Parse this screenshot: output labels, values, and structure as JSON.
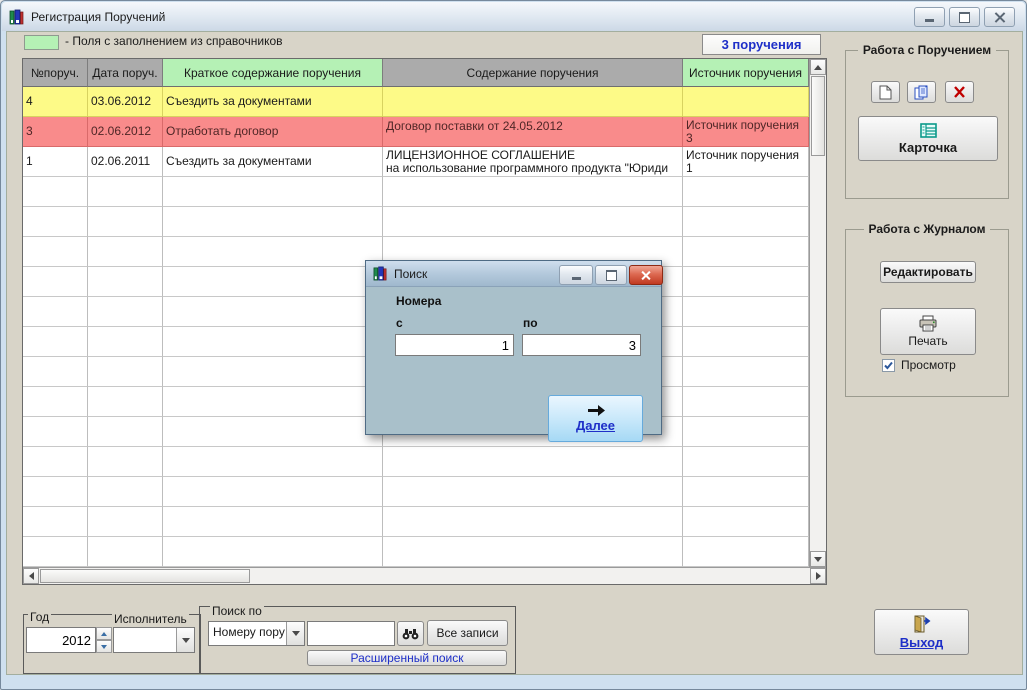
{
  "window": {
    "title": "Регистрация Поручений"
  },
  "legend_text": "- Поля с заполнением из справочников",
  "badge": "3 поручения",
  "colors": {
    "row_yellow": "#fdfa87",
    "row_pink": "#f98b8b",
    "header_green": "#b5f1b5",
    "header_gray": "#ababab",
    "link_blue": "#1e2fc8",
    "dialog_bg": "#a9c0ca"
  },
  "table": {
    "columns": [
      {
        "label": "№поруч.",
        "highlight": false
      },
      {
        "label": "Дата поруч.",
        "highlight": false
      },
      {
        "label": "Краткое содержание поручения",
        "highlight": true
      },
      {
        "label": "Содержание поручения",
        "highlight": false
      },
      {
        "label": "Источник поручения",
        "highlight": true
      }
    ],
    "rows": [
      {
        "color": "row_yellow",
        "cells": [
          "4",
          "03.06.2012",
          "Съездить за документами",
          "",
          ""
        ]
      },
      {
        "color": "row_pink",
        "cells": [
          "3",
          "02.06.2012",
          "Отработать договор",
          "Договор поставки от 24.05.2012",
          "Источник поручения 3"
        ]
      },
      {
        "color": "row_white",
        "cells": [
          "1",
          "02.06.2011",
          "Съездить за документами",
          "ЛИЦЕНЗИОННОЕ СОГЛАШЕНИЕ\nна использование программного продукта \"Юриди",
          "Источник поручения 1"
        ]
      }
    ],
    "empty_row_count": 13
  },
  "panel_assignment": {
    "legend": "Работа с Поручением",
    "card_button": "Карточка"
  },
  "panel_journal": {
    "legend": "Работа с Журналом",
    "edit_button": "Редактировать",
    "print_button": "Печать",
    "preview_label": "Просмотр"
  },
  "bottom": {
    "year_label": "Год",
    "year_value": "2012",
    "executor_label": "Исполнитель",
    "executor_value": "",
    "search_group_label": "Поиск по",
    "search_field_value": "Номеру пору",
    "search_input_value": "",
    "all_records_button": "Все записи",
    "advanced_search_button": "Расширенный поиск",
    "exit_button": "Выход"
  },
  "dialog": {
    "title": "Поиск",
    "numbers_label": "Номера",
    "from_label": "с",
    "to_label": "по",
    "from_value": "1",
    "to_value": "3",
    "next_button": "Далее"
  }
}
